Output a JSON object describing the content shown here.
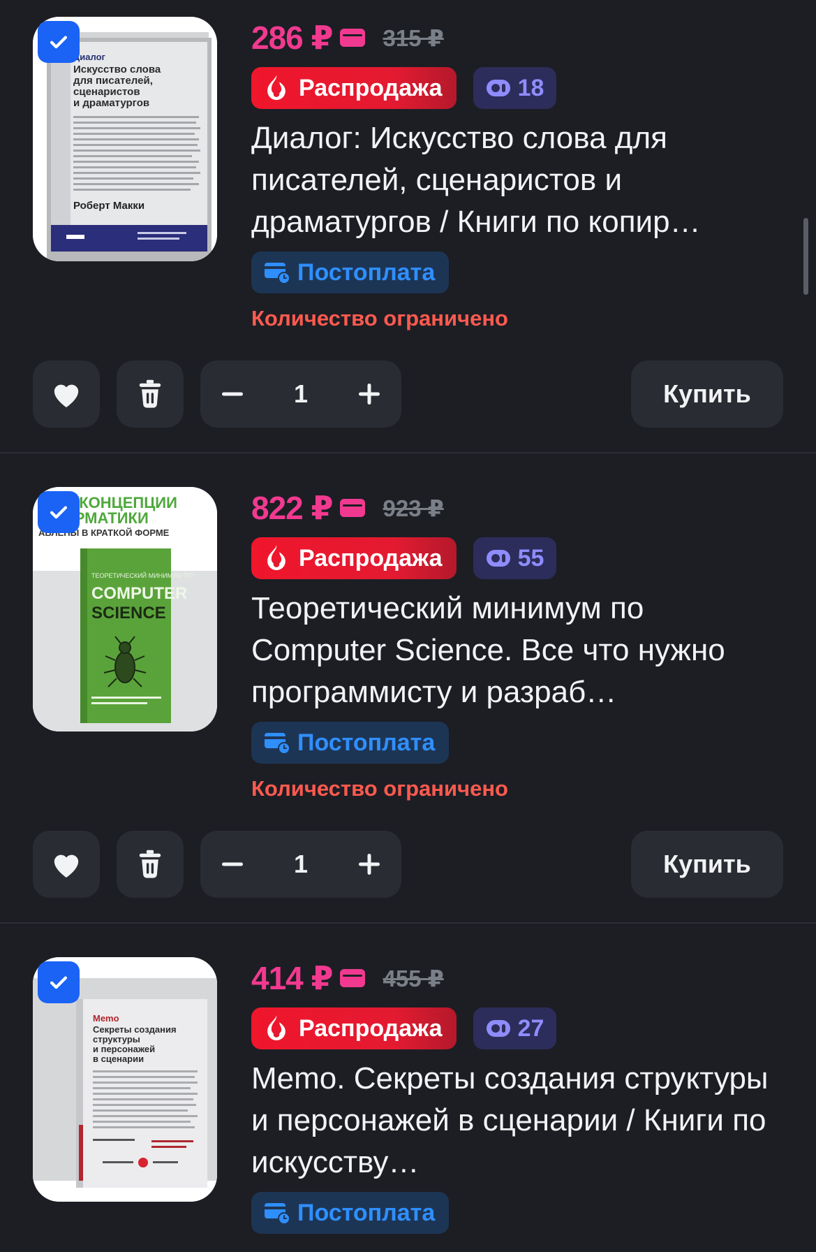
{
  "items": [
    {
      "price": "286 ₽",
      "old_price": "315 ₽",
      "sale_label": "Распродажа",
      "reviews_count": "18",
      "title": "Диалог: Искусство слова для писателей, сценаристов и драматургов / Книги по копир…",
      "payment_label": "Постоплата",
      "stock_note": "Количество ограничено",
      "quantity": "1",
      "buy_label": "Купить",
      "selected": true,
      "cover": {
        "heading": "Диалог",
        "subtitle": "Искусство слова для писателей, сценаристов и драматургов",
        "author": "Роберт Макки"
      }
    },
    {
      "price": "822 ₽",
      "old_price": "923 ₽",
      "sale_label": "Распродажа",
      "reviews_count": "55",
      "title": "Теоретический минимум по Computer Science. Все что нужно программисту и разраб…",
      "payment_label": "Постоплата",
      "stock_note": "Количество ограничено",
      "quantity": "1",
      "buy_label": "Купить",
      "selected": true,
      "cover": {
        "banner_line1": "НЫЕ КОНЦЕПЦИИ",
        "banner_line2": "НФОРМАТИКИ",
        "banner_line3": "АВЛЕНЫ В КРАТКОЙ ФОРМЕ",
        "book_line1": "ТЕОРЕТИЧЕСКИЙ МИНИМУМ ПО",
        "book_line2": "COMPUTER",
        "book_line3": "SCIENCE"
      }
    },
    {
      "price": "414 ₽",
      "old_price": "455 ₽",
      "sale_label": "Распродажа",
      "reviews_count": "27",
      "title": "Memo. Секреты создания структуры и персонажей в сценарии / Книги по искусству…",
      "payment_label": "Постоплата",
      "selected": true,
      "cover": {
        "heading": "Memo",
        "subtitle": "Секреты создания структуры и персонажей в сценарии"
      }
    }
  ],
  "colors": {
    "background": "#1c1e24",
    "price": "#f13a8f",
    "sale": "#f0162c",
    "reviews": "#8f8cff",
    "postpay": "#2f8fff",
    "limited": "#ff5a4f",
    "check": "#1a63f5"
  },
  "icons": {
    "check": "check-icon",
    "wallet": "wallet-icon",
    "fire": "fire-icon",
    "reviews": "reviews-icon",
    "postpay": "postpay-card-icon",
    "heart": "heart-icon",
    "trash": "trash-icon",
    "minus": "minus-icon",
    "plus": "plus-icon"
  }
}
